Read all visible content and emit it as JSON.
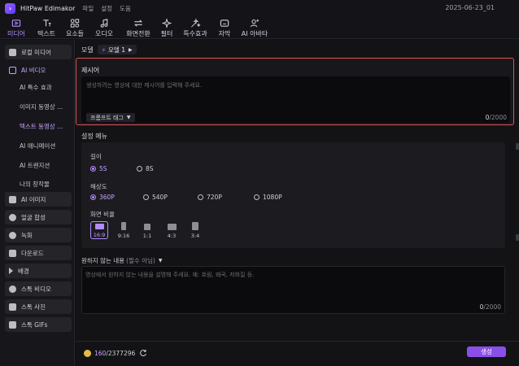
{
  "titlebar": {
    "app_title": "HitPaw Edimakor",
    "menu": [
      "파일",
      "설정",
      "도움"
    ],
    "date": "2025-06-23_01"
  },
  "toolbar": {
    "tools": [
      {
        "label": "미디어",
        "icon": "media-icon",
        "active": true
      },
      {
        "label": "텍스트",
        "icon": "text-icon",
        "active": false
      },
      {
        "label": "요소들",
        "icon": "elements-icon",
        "active": false
      },
      {
        "label": "오디오",
        "icon": "audio-icon",
        "active": false
      },
      {
        "label": "화면전환",
        "icon": "transition-icon",
        "active": false
      },
      {
        "label": "필터",
        "icon": "filter-icon",
        "active": false
      },
      {
        "label": "특수효과",
        "icon": "effects-icon",
        "active": false
      },
      {
        "label": "자막",
        "icon": "subtitle-icon",
        "active": false
      },
      {
        "label": "AI 아바타",
        "icon": "ai-avatar-icon",
        "active": false
      }
    ]
  },
  "sidebar": {
    "items": [
      {
        "label": "로컬 미디어",
        "icon": "local-media-icon"
      },
      {
        "label": "AI 비디오",
        "icon": "ai-video-icon"
      },
      {
        "label": "AI 이미지",
        "icon": "ai-image-icon"
      },
      {
        "label": "얼굴 합성",
        "icon": "face-swap-icon"
      },
      {
        "label": "녹화",
        "icon": "record-icon"
      },
      {
        "label": "다운로드",
        "icon": "download-icon"
      },
      {
        "label": "배경",
        "icon": "background-icon"
      },
      {
        "label": "스톡 비디오",
        "icon": "stock-video-icon"
      },
      {
        "label": "스톡 사진",
        "icon": "stock-photo-icon"
      },
      {
        "label": "스톡 GIFs",
        "icon": "stock-gif-icon"
      }
    ],
    "sub_items": [
      "AI 특수 효과",
      "이미지 동영상 ...",
      "텍스트 동영상 ...",
      "AI 애니메이션",
      "AI 트랜지션",
      "나의 창작물"
    ]
  },
  "main": {
    "model_label": "모델",
    "model_value": "모델 1",
    "prompt": {
      "title": "제시어",
      "placeholder": "생성하려는 영상에 대한 제시어를 입력해 주세요.",
      "tag_button": "프롬프트 태그",
      "count_current": "0",
      "count_max": "/2000"
    },
    "settings": {
      "title": "설정 메뉴",
      "length_label": "길이",
      "length_options": [
        "5S",
        "8S"
      ],
      "length_selected": "5S",
      "resolution_label": "해상도",
      "resolution_options": [
        "360P",
        "540P",
        "720P",
        "1080P"
      ],
      "resolution_selected": "360P",
      "ratio_label": "화면 비율",
      "ratio_options": [
        "16:9",
        "9:16",
        "1:1",
        "4:3",
        "3:4"
      ],
      "ratio_selected": "16:9"
    },
    "negative": {
      "title": "원하지 않는 내용",
      "optional": "(필수 아님)",
      "placeholder": "영상에서 원하지 않는 내용을 설명해 주세요. 예: 흐림, 왜곡, 저화질 등.",
      "count_current": "0",
      "count_max": "/2000"
    },
    "footer": {
      "credits_current": "160",
      "credits_total": "/2377296",
      "generate_label": "생성"
    }
  },
  "colors": {
    "accent": "#b28cff",
    "button": "#8a4fe8",
    "highlight_border": "#e05050",
    "coin": "#e8b84a"
  }
}
